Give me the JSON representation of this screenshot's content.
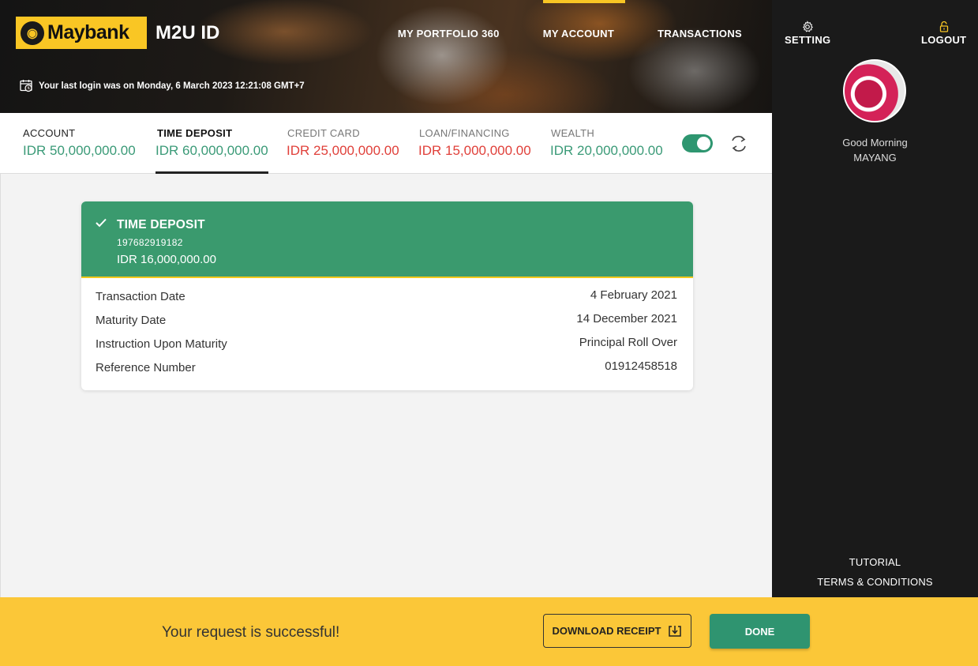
{
  "header": {
    "logo_text": "Maybank",
    "app_title": "M2U ID",
    "last_login": "Your last login was on Monday, 6 March 2023 12:21:08 GMT+7",
    "nav": [
      {
        "label": "MY PORTFOLIO 360"
      },
      {
        "label": "MY ACCOUNT"
      },
      {
        "label": "TRANSACTIONS"
      }
    ],
    "active_nav": "MY ACCOUNT"
  },
  "summary": {
    "tabs": [
      {
        "label": "ACCOUNT",
        "value": "IDR 50,000,000.00",
        "color": "#3a9a77"
      },
      {
        "label": "TIME DEPOSIT",
        "value": "IDR 60,000,000.00",
        "color": "#3a9a77"
      },
      {
        "label": "CREDIT CARD",
        "value": "IDR 25,000,000.00",
        "color": "#e0403a"
      },
      {
        "label": "LOAN/FINANCING",
        "value": "IDR 15,000,000.00",
        "color": "#e0403a"
      },
      {
        "label": "WEALTH",
        "value": "IDR 20,000,000.00",
        "color": "#3a9a77"
      }
    ],
    "active_tab": "TIME DEPOSIT",
    "toggle_on": true
  },
  "card": {
    "title": "TIME DEPOSIT",
    "account_number": "197682919182",
    "amount": "IDR 16,000,000.00",
    "details": [
      {
        "label": "Transaction Date",
        "value": "4 February 2021"
      },
      {
        "label": "Maturity Date",
        "value": "14 December 2021"
      },
      {
        "label": "Instruction Upon Maturity",
        "value": "Principal Roll Over"
      },
      {
        "label": "Reference Number",
        "value": "01912458518"
      }
    ]
  },
  "sidebar": {
    "setting_label": "SETTING",
    "logout_label": "LOGOUT",
    "greeting": "Good Morning",
    "user_name": "MAYANG",
    "tutorial_label": "TUTORIAL",
    "terms_label": "TERMS & CONDITIONS"
  },
  "footer": {
    "message": "Your request is successful!",
    "download_label": "DOWNLOAD RECEIPT",
    "done_label": "DONE"
  },
  "colors": {
    "brand_yellow": "#f9c624",
    "positive_green": "#3a9a77",
    "negative_red": "#e0403a",
    "card_header_green": "#3a9a6e",
    "sidebar_bg": "#1a1a1a",
    "footer_bg": "#fbc738"
  }
}
